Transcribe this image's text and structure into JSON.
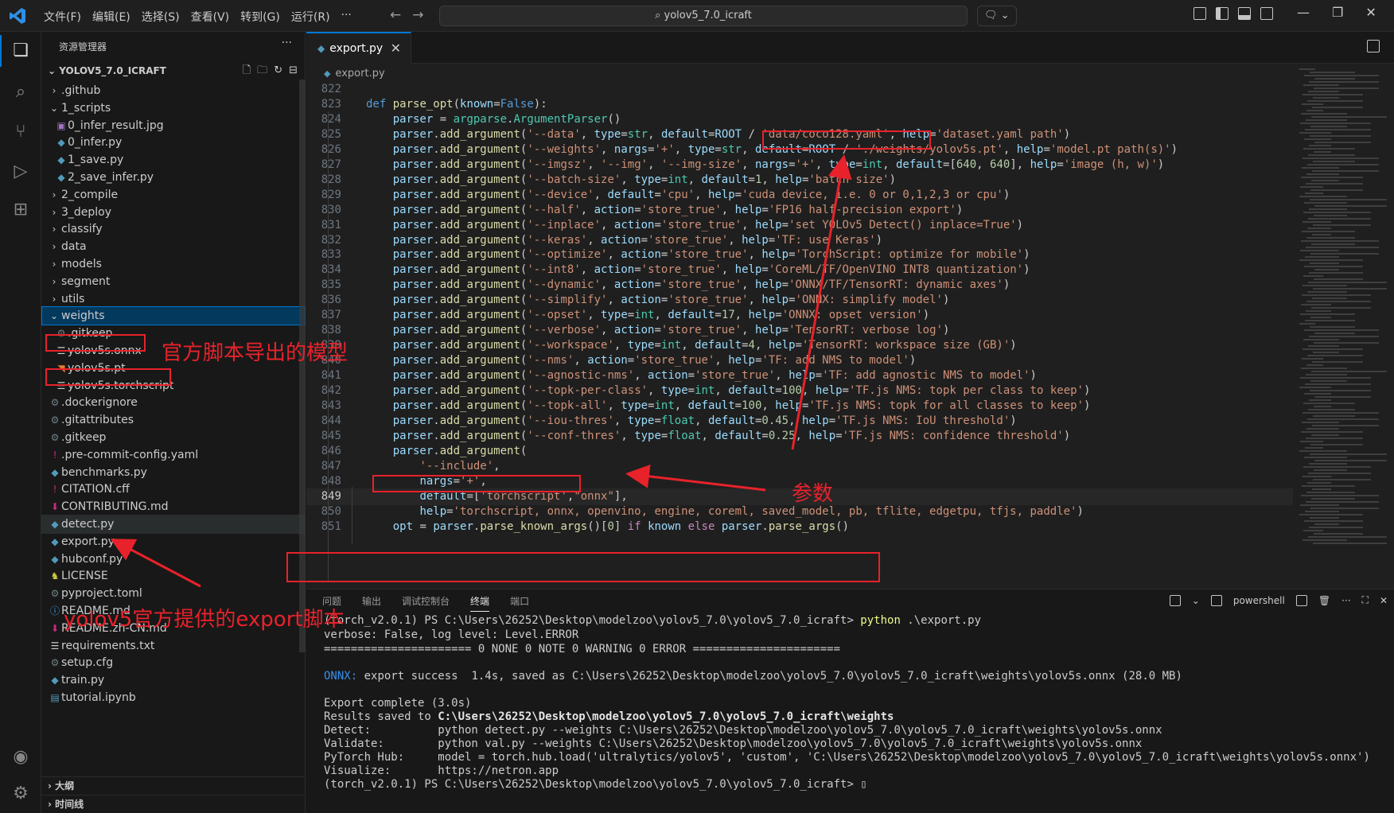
{
  "titlebar": {
    "menu": [
      "文件(F)",
      "编辑(E)",
      "选择(S)",
      "查看(V)",
      "转到(G)",
      "运行(R)",
      "···"
    ],
    "search_text": "yolov5_7.0_icraft",
    "nav_back": "←",
    "nav_forward": "→"
  },
  "sidebar": {
    "header": "资源管理器",
    "project": "YOLOV5_7.0_ICRAFT",
    "items": [
      {
        "label": ".github",
        "type": "folder",
        "depth": 1,
        "open": false
      },
      {
        "label": "1_scripts",
        "type": "folder",
        "depth": 1,
        "open": true
      },
      {
        "label": "0_infer_result.jpg",
        "type": "img",
        "depth": 2
      },
      {
        "label": "0_infer.py",
        "type": "py",
        "depth": 2
      },
      {
        "label": "1_save.py",
        "type": "py",
        "depth": 2
      },
      {
        "label": "2_save_infer.py",
        "type": "py",
        "depth": 2
      },
      {
        "label": "2_compile",
        "type": "folder",
        "depth": 1,
        "open": false
      },
      {
        "label": "3_deploy",
        "type": "folder",
        "depth": 1,
        "open": false
      },
      {
        "label": "classify",
        "type": "folder",
        "depth": 1,
        "open": false
      },
      {
        "label": "data",
        "type": "folder",
        "depth": 1,
        "open": false
      },
      {
        "label": "models",
        "type": "folder",
        "depth": 1,
        "open": false
      },
      {
        "label": "segment",
        "type": "folder",
        "depth": 1,
        "open": false
      },
      {
        "label": "utils",
        "type": "folder",
        "depth": 1,
        "open": false
      },
      {
        "label": "weights",
        "type": "folder",
        "depth": 1,
        "open": true,
        "selected": true
      },
      {
        "label": ".gitkeep",
        "type": "gear",
        "depth": 2
      },
      {
        "label": "yolov5s.onnx",
        "type": "file",
        "depth": 2
      },
      {
        "label": "yolov5s.pt",
        "type": "rss",
        "depth": 2
      },
      {
        "label": "yolov5s.torchscript",
        "type": "file",
        "depth": 2
      },
      {
        "label": ".dockerignore",
        "type": "gear",
        "depth": 1
      },
      {
        "label": ".gitattributes",
        "type": "gear",
        "depth": 1
      },
      {
        "label": ".gitkeep",
        "type": "gear",
        "depth": 1
      },
      {
        "label": ".pre-commit-config.yaml",
        "type": "yaml",
        "depth": 1
      },
      {
        "label": "benchmarks.py",
        "type": "py",
        "depth": 1
      },
      {
        "label": "CITATION.cff",
        "type": "yaml",
        "depth": 1
      },
      {
        "label": "CONTRIBUTING.md",
        "type": "md",
        "depth": 1
      },
      {
        "label": "detect.py",
        "type": "py",
        "depth": 1,
        "hover": true
      },
      {
        "label": "export.py",
        "type": "py",
        "depth": 1
      },
      {
        "label": "hubconf.py",
        "type": "py",
        "depth": 1
      },
      {
        "label": "LICENSE",
        "type": "lic",
        "depth": 1
      },
      {
        "label": "pyproject.toml",
        "type": "gear",
        "depth": 1
      },
      {
        "label": "README.md",
        "type": "info",
        "depth": 1
      },
      {
        "label": "README.zh-CN.md",
        "type": "md",
        "depth": 1
      },
      {
        "label": "requirements.txt",
        "type": "file",
        "depth": 1
      },
      {
        "label": "setup.cfg",
        "type": "gear",
        "depth": 1
      },
      {
        "label": "train.py",
        "type": "py",
        "depth": 1
      },
      {
        "label": "tutorial.ipynb",
        "type": "nb",
        "depth": 1
      }
    ],
    "outline": "大纲",
    "timeline": "时间线"
  },
  "editor": {
    "tab": "export.py",
    "breadcrumb": "export.py",
    "current_line": 849,
    "lines": [
      {
        "n": "822",
        "h": ""
      },
      {
        "n": "823",
        "h": "<span class='k'>def</span> <span class='f'>parse_opt</span>(<span class='p'>known</span>=<span class='k'>False</span>):"
      },
      {
        "n": "824",
        "h": "    <span class='p'>parser</span> = <span class='t'>argparse</span>.<span class='t'>ArgumentParser</span>()"
      },
      {
        "n": "825",
        "h": "    <span class='p'>parser</span>.<span class='f'>add_argument</span>(<span class='s'>'--data'</span>, <span class='p'>type</span>=<span class='t'>str</span>, <span class='p'>default</span>=<span class='p'>ROOT</span> / <span class='s'>'data/coco128.yaml'</span>, <span class='p'>help</span>=<span class='s'>'dataset.yaml path'</span>)"
      },
      {
        "n": "826",
        "h": "    <span class='p'>parser</span>.<span class='f'>add_argument</span>(<span class='s'>'--weights'</span>, <span class='p'>nargs</span>=<span class='s'>'+'</span>, <span class='p'>type</span>=<span class='t'>str</span>, <span class='p'>default</span>=<span class='p'>ROOT</span> / <span class='s'>'./weights/yolov5s.pt'</span>, <span class='p'>help</span>=<span class='s'>'model.pt path(s)'</span>)"
      },
      {
        "n": "827",
        "h": "    <span class='p'>parser</span>.<span class='f'>add_argument</span>(<span class='s'>'--imgsz'</span>, <span class='s'>'--img'</span>, <span class='s'>'--img-size'</span>, <span class='p'>nargs</span>=<span class='s'>'+'</span>, <span class='p'>type</span>=<span class='t'>int</span>, <span class='p'>default</span>=[<span class='n'>640</span>, <span class='n'>640</span>], <span class='p'>help</span>=<span class='s'>'image (h, w)'</span>)"
      },
      {
        "n": "828",
        "h": "    <span class='p'>parser</span>.<span class='f'>add_argument</span>(<span class='s'>'--batch-size'</span>, <span class='p'>type</span>=<span class='t'>int</span>, <span class='p'>default</span>=<span class='n'>1</span>, <span class='p'>help</span>=<span class='s'>'batch size'</span>)"
      },
      {
        "n": "829",
        "h": "    <span class='p'>parser</span>.<span class='f'>add_argument</span>(<span class='s'>'--device'</span>, <span class='p'>default</span>=<span class='s'>'cpu'</span>, <span class='p'>help</span>=<span class='s'>'cuda device, i.e. 0 or 0,1,2,3 or cpu'</span>)"
      },
      {
        "n": "830",
        "h": "    <span class='p'>parser</span>.<span class='f'>add_argument</span>(<span class='s'>'--half'</span>, <span class='p'>action</span>=<span class='s'>'store_true'</span>, <span class='p'>help</span>=<span class='s'>'FP16 half-precision export'</span>)"
      },
      {
        "n": "831",
        "h": "    <span class='p'>parser</span>.<span class='f'>add_argument</span>(<span class='s'>'--inplace'</span>, <span class='p'>action</span>=<span class='s'>'store_true'</span>, <span class='p'>help</span>=<span class='s'>'set YOLOv5 Detect() inplace=True'</span>)"
      },
      {
        "n": "832",
        "h": "    <span class='p'>parser</span>.<span class='f'>add_argument</span>(<span class='s'>'--keras'</span>, <span class='p'>action</span>=<span class='s'>'store_true'</span>, <span class='p'>help</span>=<span class='s'>'TF: use Keras'</span>)"
      },
      {
        "n": "833",
        "h": "    <span class='p'>parser</span>.<span class='f'>add_argument</span>(<span class='s'>'--optimize'</span>, <span class='p'>action</span>=<span class='s'>'store_true'</span>, <span class='p'>help</span>=<span class='s'>'TorchScript: optimize for mobile'</span>)"
      },
      {
        "n": "834",
        "h": "    <span class='p'>parser</span>.<span class='f'>add_argument</span>(<span class='s'>'--int8'</span>, <span class='p'>action</span>=<span class='s'>'store_true'</span>, <span class='p'>help</span>=<span class='s'>'CoreML/TF/OpenVINO INT8 quantization'</span>)"
      },
      {
        "n": "835",
        "h": "    <span class='p'>parser</span>.<span class='f'>add_argument</span>(<span class='s'>'--dynamic'</span>, <span class='p'>action</span>=<span class='s'>'store_true'</span>, <span class='p'>help</span>=<span class='s'>'ONNX/TF/TensorRT: dynamic axes'</span>)"
      },
      {
        "n": "836",
        "h": "    <span class='p'>parser</span>.<span class='f'>add_argument</span>(<span class='s'>'--simplify'</span>, <span class='p'>action</span>=<span class='s'>'store_true'</span>, <span class='p'>help</span>=<span class='s'>'ONNX: simplify model'</span>)"
      },
      {
        "n": "837",
        "h": "    <span class='p'>parser</span>.<span class='f'>add_argument</span>(<span class='s'>'--opset'</span>, <span class='p'>type</span>=<span class='t'>int</span>, <span class='p'>default</span>=<span class='n'>17</span>, <span class='p'>help</span>=<span class='s'>'ONNX: opset version'</span>)"
      },
      {
        "n": "838",
        "h": "    <span class='p'>parser</span>.<span class='f'>add_argument</span>(<span class='s'>'--verbose'</span>, <span class='p'>action</span>=<span class='s'>'store_true'</span>, <span class='p'>help</span>=<span class='s'>'TensorRT: verbose log'</span>)"
      },
      {
        "n": "839",
        "h": "    <span class='p'>parser</span>.<span class='f'>add_argument</span>(<span class='s'>'--workspace'</span>, <span class='p'>type</span>=<span class='t'>int</span>, <span class='p'>default</span>=<span class='n'>4</span>, <span class='p'>help</span>=<span class='s'>'TensorRT: workspace size (GB)'</span>)"
      },
      {
        "n": "840",
        "h": "    <span class='p'>parser</span>.<span class='f'>add_argument</span>(<span class='s'>'--nms'</span>, <span class='p'>action</span>=<span class='s'>'store_true'</span>, <span class='p'>help</span>=<span class='s'>'TF: add NMS to model'</span>)"
      },
      {
        "n": "841",
        "h": "    <span class='p'>parser</span>.<span class='f'>add_argument</span>(<span class='s'>'--agnostic-nms'</span>, <span class='p'>action</span>=<span class='s'>'store_true'</span>, <span class='p'>help</span>=<span class='s'>'TF: add agnostic NMS to model'</span>)"
      },
      {
        "n": "842",
        "h": "    <span class='p'>parser</span>.<span class='f'>add_argument</span>(<span class='s'>'--topk-per-class'</span>, <span class='p'>type</span>=<span class='t'>int</span>, <span class='p'>default</span>=<span class='n'>100</span>, <span class='p'>help</span>=<span class='s'>'TF.js NMS: topk per class to keep'</span>)"
      },
      {
        "n": "843",
        "h": "    <span class='p'>parser</span>.<span class='f'>add_argument</span>(<span class='s'>'--topk-all'</span>, <span class='p'>type</span>=<span class='t'>int</span>, <span class='p'>default</span>=<span class='n'>100</span>, <span class='p'>help</span>=<span class='s'>'TF.js NMS: topk for all classes to keep'</span>)"
      },
      {
        "n": "844",
        "h": "    <span class='p'>parser</span>.<span class='f'>add_argument</span>(<span class='s'>'--iou-thres'</span>, <span class='p'>type</span>=<span class='t'>float</span>, <span class='p'>default</span>=<span class='n'>0.45</span>, <span class='p'>help</span>=<span class='s'>'TF.js NMS: IoU threshold'</span>)"
      },
      {
        "n": "845",
        "h": "    <span class='p'>parser</span>.<span class='f'>add_argument</span>(<span class='s'>'--conf-thres'</span>, <span class='p'>type</span>=<span class='t'>float</span>, <span class='p'>default</span>=<span class='n'>0.25</span>, <span class='p'>help</span>=<span class='s'>'TF.js NMS: confidence threshold'</span>)"
      },
      {
        "n": "846",
        "h": "    <span class='p'>parser</span>.<span class='f'>add_argument</span>("
      },
      {
        "n": "847",
        "h": "        <span class='s'>'--include'</span>,"
      },
      {
        "n": "848",
        "h": "        <span class='p'>nargs</span>=<span class='s'>'+'</span>,"
      },
      {
        "n": "849",
        "h": "        <span class='p'>default</span>=[<span class='s'>'torchscript'</span>,<span class='s'>\"onnx\"</span>],"
      },
      {
        "n": "850",
        "h": "        <span class='p'>help</span>=<span class='s'>'torchscript, onnx, openvino, engine, coreml, saved_model, pb, tflite, edgetpu, tfjs, paddle'</span>)"
      },
      {
        "n": "851",
        "h": "    <span class='p'>opt</span> = <span class='p'>parser</span>.<span class='f'>parse_known_args</span>()[<span class='n'>0</span>] <span class='kw'>if</span> <span class='p'>known</span> <span class='kw'>else</span> <span class='p'>parser</span>.<span class='f'>parse_args</span>()"
      }
    ]
  },
  "panel": {
    "tabs": [
      "问题",
      "输出",
      "调试控制台",
      "终端",
      "端口"
    ],
    "active_tab": "终端",
    "shell": "powershell",
    "terminal": [
      {
        "h": "(torch_v2.0.1) PS C:\\Users\\26252\\Desktop\\modelzoo\\yolov5_7.0\\yolov5_7.0_icraft&gt; <span class='yl'>python</span> .\\export.py"
      },
      {
        "h": "verbose: False, log level: Level.ERROR"
      },
      {
        "h": "====================== 0 NONE 0 NOTE 0 WARNING 0 ERROR ======================"
      },
      {
        "h": ""
      },
      {
        "h": "<span class='cy'>ONNX:</span> export success  1.4s, saved as C:\\Users\\26252\\Desktop\\modelzoo\\yolov5_7.0\\yolov5_7.0_icraft\\weights\\yolov5s.onnx (28.0 MB)"
      },
      {
        "h": ""
      },
      {
        "h": "Export complete (3.0s)"
      },
      {
        "h": "Results saved to <span class='bd'>C:\\Users\\26252\\Desktop\\modelzoo\\yolov5_7.0\\yolov5_7.0_icraft\\weights</span>"
      },
      {
        "h": "Detect:          python detect.py --weights C:\\Users\\26252\\Desktop\\modelzoo\\yolov5_7.0\\yolov5_7.0_icraft\\weights\\yolov5s.onnx"
      },
      {
        "h": "Validate:        python val.py --weights C:\\Users\\26252\\Desktop\\modelzoo\\yolov5_7.0\\yolov5_7.0_icraft\\weights\\yolov5s.onnx"
      },
      {
        "h": "PyTorch Hub:     model = torch.hub.load('ultralytics/yolov5', 'custom', 'C:\\Users\\26252\\Desktop\\modelzoo\\yolov5_7.0\\yolov5_7.0_icraft\\weights\\yolov5s.onnx')"
      },
      {
        "h": "Visualize:       https://netron.app"
      },
      {
        "h": "(torch_v2.0.1) PS C:\\Users\\26252\\Desktop\\modelzoo\\yolov5_7.0\\yolov5_7.0_icraft&gt; ▯"
      }
    ]
  },
  "annotations": {
    "model_exported": "官方脚本导出的模型",
    "params": "参数",
    "export_script": "yolov5官方提供的export脚本"
  },
  "colors": {
    "accent": "#0078d4",
    "annotation": "#e8222b"
  }
}
